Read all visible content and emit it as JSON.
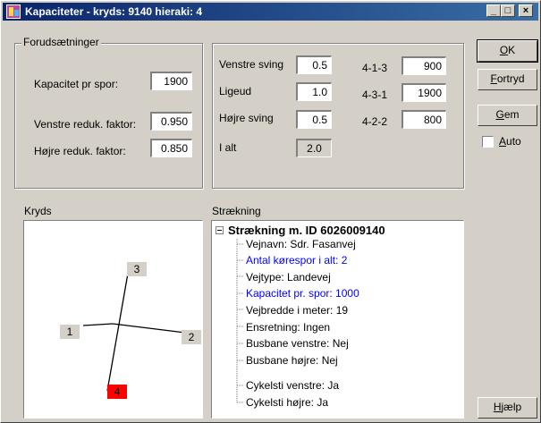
{
  "window": {
    "title": "Kapaciteter - kryds: 9140 hieraki: 4",
    "min_label": "_",
    "max_label": "□",
    "close_label": "×"
  },
  "forudsaetninger": {
    "title": "Forudsætninger",
    "kapacitet_label": "Kapacitet pr spor:",
    "kapacitet_value": "1900",
    "venstre_label": "Venstre reduk. faktor:",
    "venstre_value": "0.950",
    "hoejre_label": "Højre reduk. faktor:",
    "hoejre_value": "0.850"
  },
  "turns": {
    "venstre_label": "Venstre sving",
    "venstre_value": "0.5",
    "ligeud_label": "Ligeud",
    "ligeud_value": "1.0",
    "hoejre_label": "Højre sving",
    "hoejre_value": "0.5",
    "ialt_label": "I alt",
    "ialt_value": "2.0",
    "codes": [
      {
        "label": "4-1-3",
        "value": "900"
      },
      {
        "label": "4-3-1",
        "value": "1900"
      },
      {
        "label": "4-2-2",
        "value": "800"
      }
    ]
  },
  "kryds": {
    "title": "Kryds",
    "nodes": [
      "3",
      "1",
      "2",
      "4"
    ],
    "highlight_color": "#ff0000"
  },
  "straekning": {
    "title": "Strækning",
    "root": "Strækning m. ID 6026009140",
    "items": [
      {
        "text": "Vejnavn: Sdr. Fasanvej",
        "blue": false
      },
      {
        "text": "Antal kørespor i alt: 2",
        "blue": true
      },
      {
        "text": "Vejtype: Landevej",
        "blue": false
      },
      {
        "text": "Kapacitet pr. spor: 1000",
        "blue": true
      },
      {
        "text": "Vejbredde i meter: 19",
        "blue": false
      },
      {
        "text": "Ensretning: Ingen",
        "blue": false
      },
      {
        "text": "Busbane venstre: Nej",
        "blue": false
      },
      {
        "text": "Busbane højre: Nej",
        "blue": false
      },
      {
        "text": "Cykelsti venstre: Ja",
        "blue": false
      },
      {
        "text": "Cykelsti højre: Ja",
        "blue": false
      }
    ]
  },
  "buttons": {
    "ok": {
      "first": "O",
      "rest": "K"
    },
    "fortryd": {
      "first": "F",
      "rest": "ortryd"
    },
    "gem": {
      "first": "G",
      "rest": "em"
    },
    "auto": {
      "first": "A",
      "rest": "uto"
    },
    "hjaelp": {
      "first": "H",
      "rest": "jælp"
    },
    "auto_checked": false
  }
}
